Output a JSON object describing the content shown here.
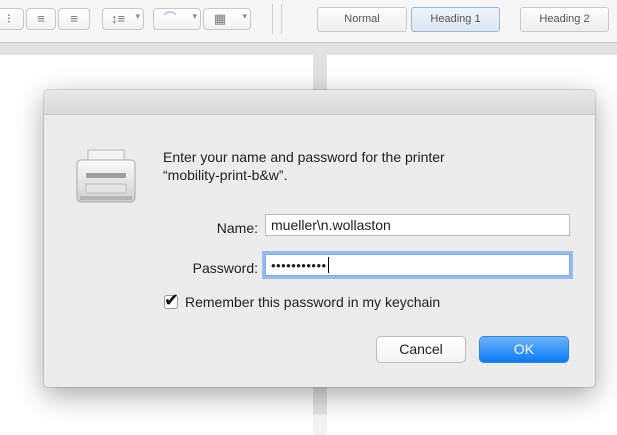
{
  "toolbar": {
    "icons": [
      "align-right-icon",
      "justify-icon",
      "line-spacing-icon",
      "highlight-icon",
      "table-icon"
    ],
    "styles": [
      {
        "label": "Normal",
        "active": false
      },
      {
        "label": "Heading 1",
        "active": true
      },
      {
        "label": "Heading 2",
        "active": false
      }
    ]
  },
  "dialog": {
    "message_line1": "Enter your name and password for the printer",
    "message_line2": "“mobility-print-b&w”.",
    "name_label": "Name:",
    "name_value": "mueller\\n.wollaston",
    "password_label": "Password:",
    "password_value": "•••••••••••",
    "remember_label": "Remember this password in my keychain",
    "remember_checked": true,
    "cancel_label": "Cancel",
    "ok_label": "OK",
    "accent_color": "#1a83f6"
  }
}
